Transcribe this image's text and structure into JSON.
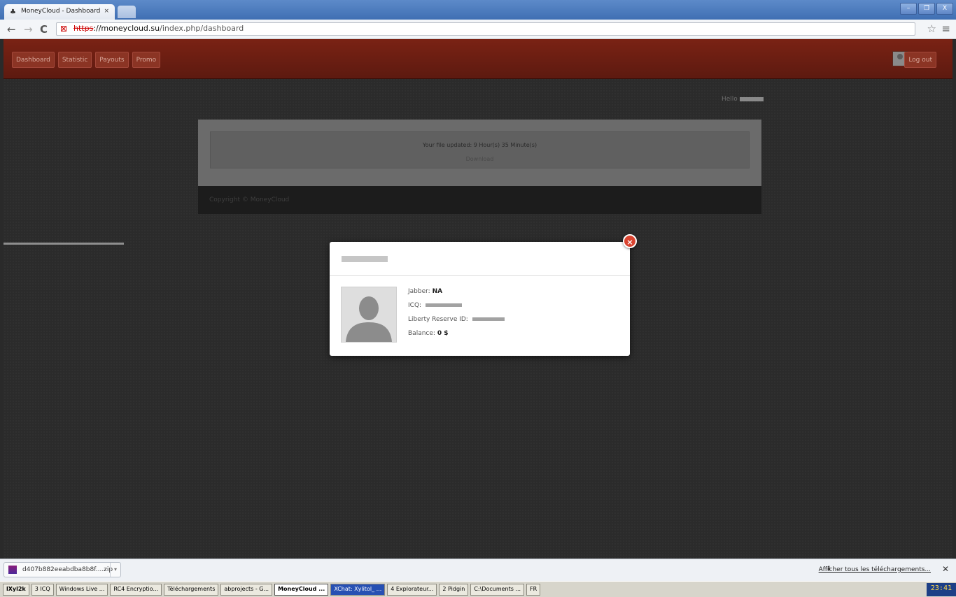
{
  "browser": {
    "tab_title": "MoneyCloud - Dashboard",
    "tab_close": "×",
    "url_scheme": "https",
    "url_host": "://moneycloud.su",
    "url_path": "/index.php/dashboard",
    "window_controls": [
      "–",
      "❐",
      "X"
    ]
  },
  "navbar": {
    "buttons": [
      "Dashboard",
      "Statistic",
      "Payouts",
      "Promo"
    ],
    "logout_label": "Log out"
  },
  "page": {
    "hello_label": "Hello",
    "file_updated": "Your file updated: 9 Hour(s) 35 Minute(s)",
    "download_label": "Download",
    "copyright": "Copyright © MoneyCloud"
  },
  "modal": {
    "close_label": "×",
    "jabber_label": "Jabber:",
    "jabber_value": "NA",
    "icq_label": "ICQ:",
    "lr_label": "Liberty Reserve ID:",
    "balance_label": "Balance:",
    "balance_value": "0 $"
  },
  "downloads": {
    "file_name": "d407b882eeabdba8b8f....zip",
    "show_all": "Afficher tous les téléchargements...",
    "close": "✕"
  },
  "taskbar": {
    "start_label": "lXyl2k",
    "items": [
      {
        "label": "3 ICQ",
        "state": "normal"
      },
      {
        "label": "Windows Live ...",
        "state": "normal"
      },
      {
        "label": "RC4 Encryptio...",
        "state": "normal"
      },
      {
        "label": "Téléchargements",
        "state": "normal"
      },
      {
        "label": "abprojects - G...",
        "state": "normal"
      },
      {
        "label": "MoneyCloud ...",
        "state": "active"
      },
      {
        "label": "XChat: Xylitol_ ...",
        "state": "xchat"
      },
      {
        "label": "4 Explorateur...",
        "state": "normal"
      },
      {
        "label": "2 Pidgin",
        "state": "normal"
      },
      {
        "label": "C:\\Documents ...",
        "state": "normal"
      }
    ],
    "lang": "FR",
    "clock": "23:41"
  },
  "colors": {
    "navbar": "#6e1f13",
    "page_bg": "#2b2b2b",
    "modal_close": "#d9432f"
  }
}
